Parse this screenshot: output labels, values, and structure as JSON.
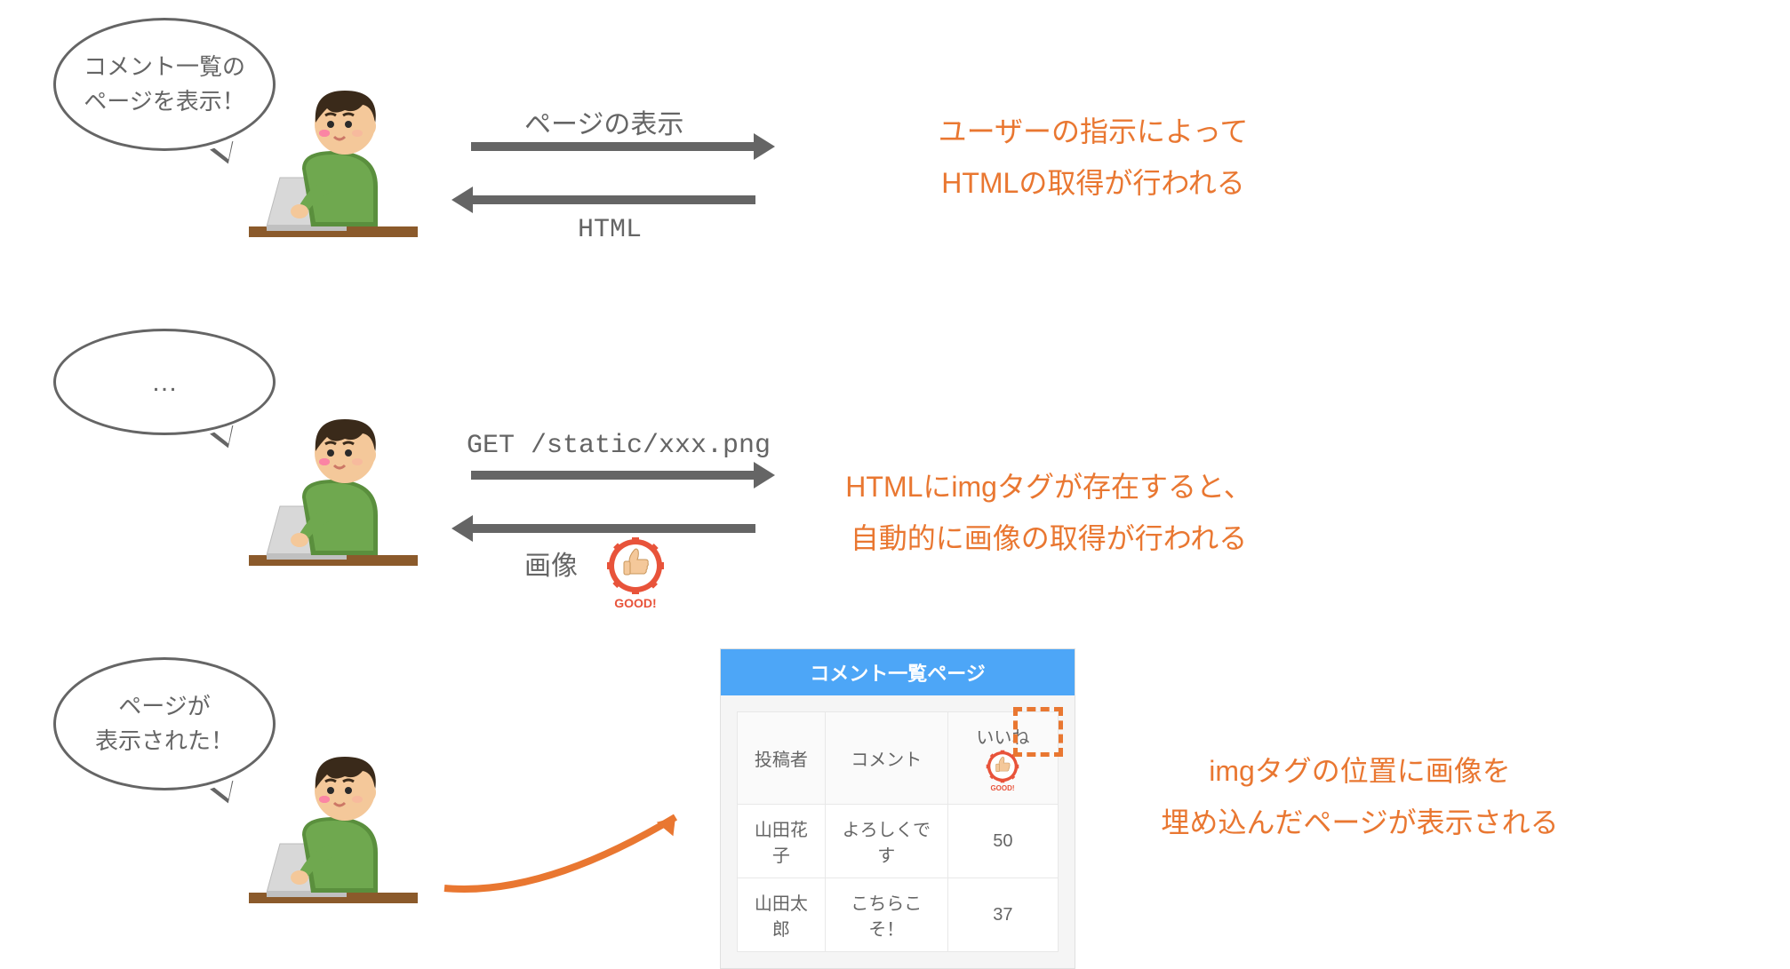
{
  "bubbles": {
    "b1": "コメント一覧の\nページを表示！",
    "b2": "…",
    "b3": "ページが\n表示された！"
  },
  "arrows": {
    "row1_top": "ページの表示",
    "row1_bottom": "HTML",
    "row2_top": "GET /static/xxx.png",
    "row2_bottom": "画像"
  },
  "explain": {
    "e1_l1": "ユーザーの指示によって",
    "e1_l2": "HTMLの取得が行われる",
    "e2_l1": "HTMLにimgタグが存在すると、",
    "e2_l2": "自動的に画像の取得が行われる",
    "e3_l1": "imgタグの位置に画像を",
    "e3_l2": "埋め込んだページが表示される"
  },
  "stamp_label": "GOOD!",
  "preview": {
    "title": "コメント一覧ページ",
    "headers": {
      "author": "投稿者",
      "comment": "コメント",
      "likes": "いいね"
    },
    "rows": [
      {
        "author": "山田花子",
        "comment": "よろしくです",
        "likes": "50"
      },
      {
        "author": "山田太郎",
        "comment": "こちらこそ！",
        "likes": "37"
      }
    ]
  }
}
